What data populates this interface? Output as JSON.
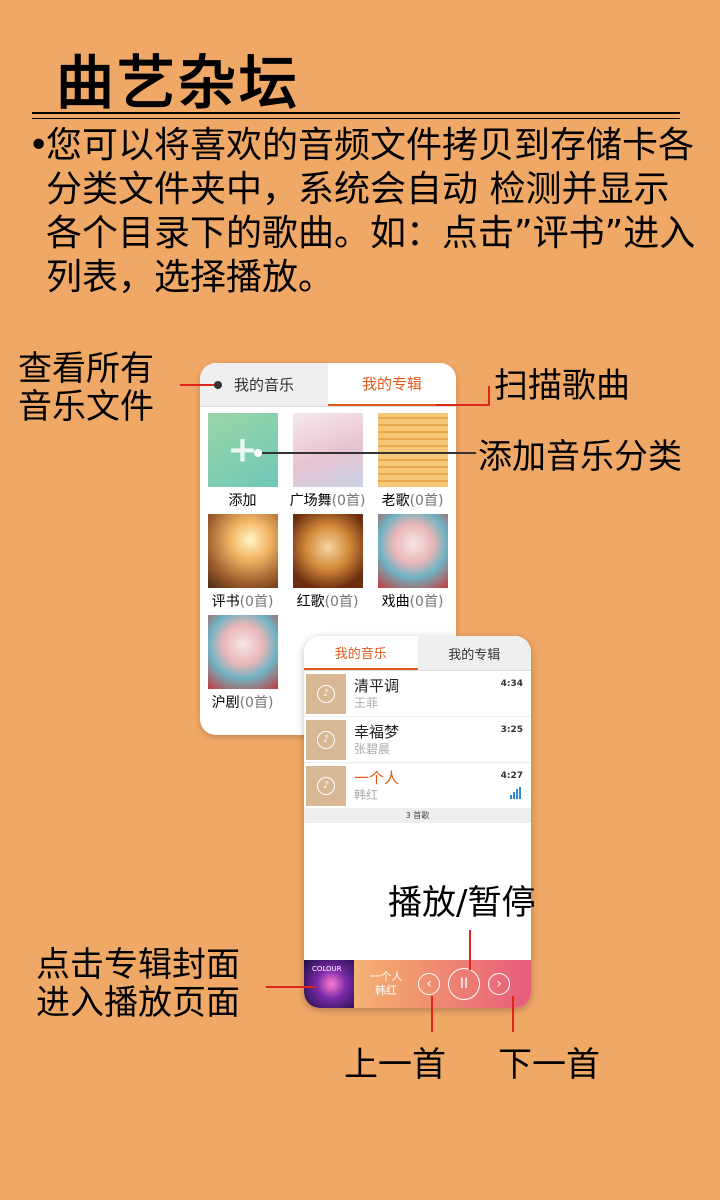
{
  "title": "曲艺杂坛",
  "description": {
    "bullet": "•",
    "text": "您可以将喜欢的音频文件拷贝到存储卡各分类文件夹中，系统会自动 检测并显示各个目录下的歌曲。如：点击”评书”进入列表，选择播放。"
  },
  "annotations": {
    "view_all_line1": "查看所有",
    "view_all_line2": "音乐文件",
    "scan_songs": "扫描歌曲",
    "add_category": "添加音乐分类",
    "play_pause": "播放/暂停",
    "click_cover_line1": "点击专辑封面",
    "click_cover_line2": "进入播放页面",
    "prev": "上一首",
    "next": "下一首"
  },
  "card1": {
    "tabs": [
      "我的音乐",
      "我的专辑"
    ],
    "categories": [
      {
        "name": "添加",
        "count": ""
      },
      {
        "name": "广场舞",
        "count": "(0首)"
      },
      {
        "name": "老歌",
        "count": "(0首)"
      },
      {
        "name": "评书",
        "count": "(0首)"
      },
      {
        "name": "红歌",
        "count": "(0首)"
      },
      {
        "name": "戏曲",
        "count": "(0首)"
      },
      {
        "name": "沪剧",
        "count": "(0首)"
      }
    ]
  },
  "card2": {
    "tabs": [
      "我的音乐",
      "我的专辑"
    ],
    "songs": [
      {
        "title": "清平调",
        "artist": "王菲",
        "duration": "4:34"
      },
      {
        "title": "幸福梦",
        "artist": "张碧晨",
        "duration": "3:25"
      },
      {
        "title": "一个人",
        "artist": "韩红",
        "duration": "4:27"
      }
    ],
    "song_count": "3 首歌",
    "now_playing": {
      "title": "一个人",
      "artist": "韩红",
      "album_text": "COLOUR"
    },
    "controls": {
      "prev": "‹",
      "pause": "II",
      "next": "›"
    }
  },
  "colors": {
    "background": "#F0A866",
    "accent": "#E05A1E",
    "annotation_line": "#E1251B"
  }
}
